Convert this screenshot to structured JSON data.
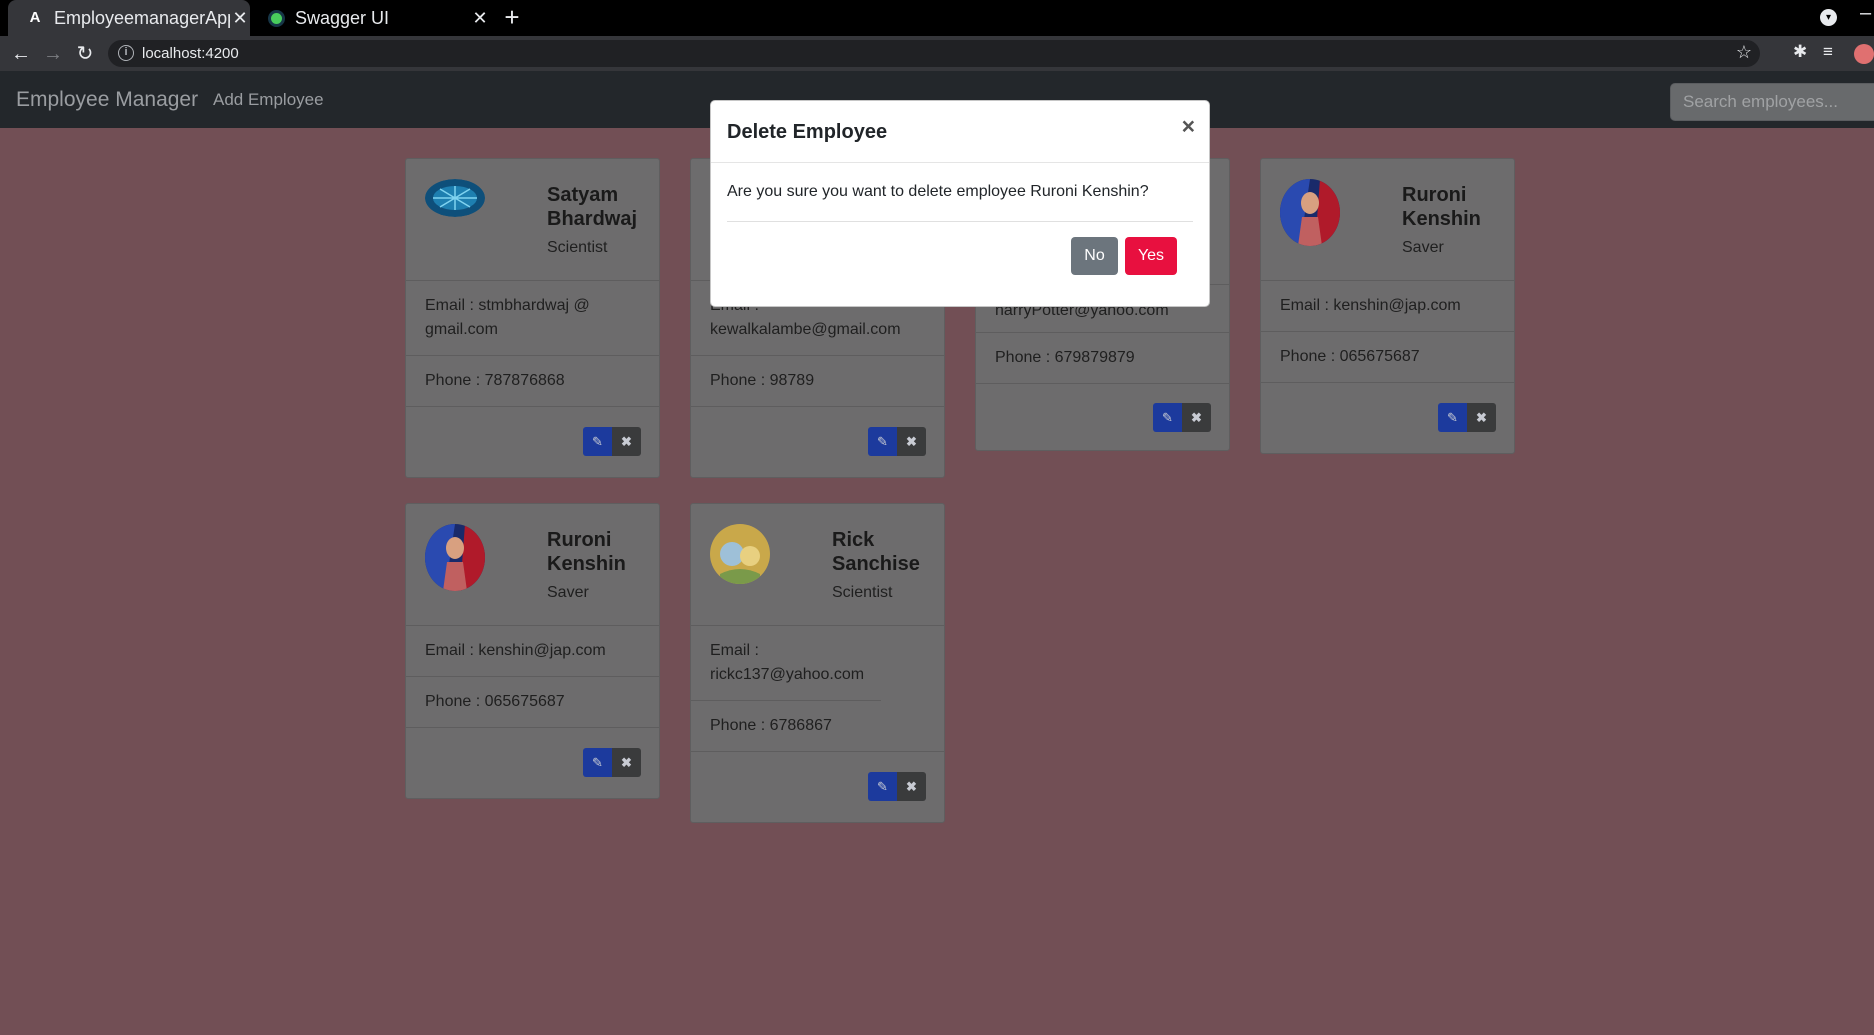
{
  "browser": {
    "tabs": [
      {
        "title": "EmployeemanagerApp",
        "active": true
      },
      {
        "title": "Swagger UI",
        "active": false
      }
    ],
    "url": "localhost:4200"
  },
  "app": {
    "brand": "Employee Manager",
    "add_link": "Add Employee",
    "search_placeholder": "Search employees..."
  },
  "employees": [
    {
      "name": "Satyam Bhardwaj",
      "title": "Scientist",
      "email_label": "Email : stmbhardwaj @ gmail.com",
      "phone_label": "Phone : 787876868",
      "avatar": "blue-circuit"
    },
    {
      "name": "",
      "title": "",
      "email_label": "Email : kewalkalambe@gmail.com",
      "phone_label": "Phone : 98789",
      "avatar": "hidden"
    },
    {
      "name": "",
      "title": "",
      "email_label": "harryPotter@yahoo.com",
      "phone_label": "Phone : 679879879",
      "avatar": "hidden"
    },
    {
      "name": "Ruroni Kenshin",
      "title": "Saver",
      "email_label": "Email : kenshin@jap.com",
      "phone_label": "Phone : 065675687",
      "avatar": "samurai"
    },
    {
      "name": "Ruroni Kenshin",
      "title": "Saver",
      "email_label": "Email : kenshin@jap.com",
      "phone_label": "Phone : 065675687",
      "avatar": "samurai"
    },
    {
      "name": "Rick Sanchise",
      "title": "Scientist",
      "email_label": "Email : rickc137@yahoo.com",
      "phone_label": "Phone : 6786867",
      "avatar": "rick"
    }
  ],
  "modal": {
    "title": "Delete Employee",
    "close_symbol": "×",
    "message": "Are you sure you want to delete employee Ruroni Kenshin?",
    "no_label": "No",
    "yes_label": "Yes"
  },
  "icons": {
    "edit": "pencil-icon",
    "delete": "x-icon"
  },
  "colors": {
    "page_bg": "#724f55",
    "navbar": "#23272b",
    "edit_btn": "#1c3a9d",
    "yes_btn": "#e8103f",
    "no_btn": "#6c757d"
  }
}
